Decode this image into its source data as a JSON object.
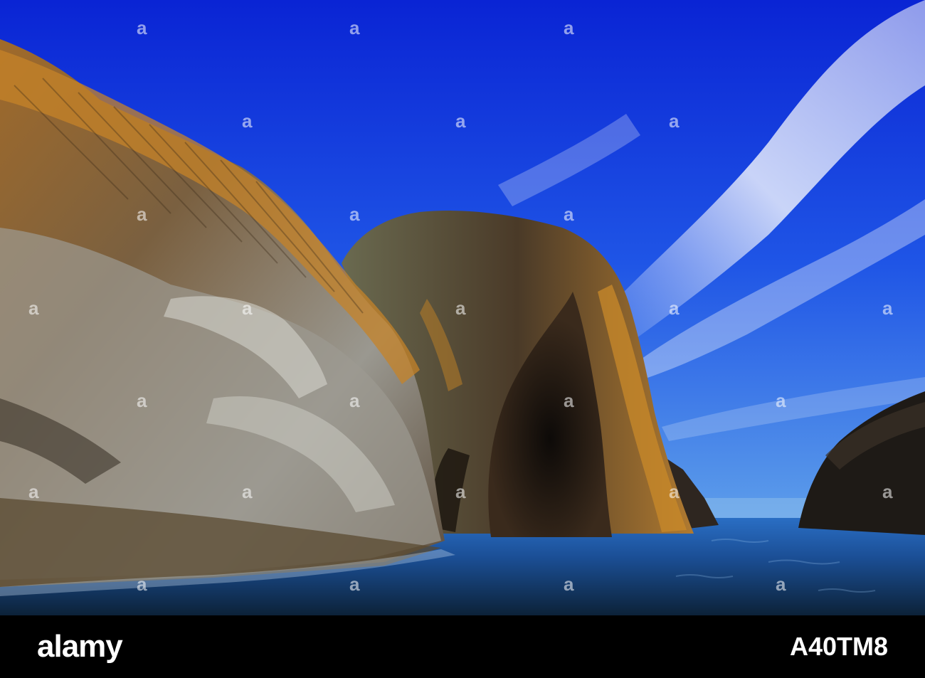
{
  "footer": {
    "logo_text": "alamy",
    "image_id": "A40TM8"
  },
  "watermark": {
    "glyph": "a"
  },
  "colors": {
    "sky_top": "#0a2ad8",
    "sky_bottom": "#4a8fe8",
    "sea": "#1f5fb0",
    "sea_dark": "#0f2a44",
    "lichen_orange": "#c98a2a",
    "rock_grey": "#8a8a82",
    "rock_dark": "#2a2520"
  }
}
